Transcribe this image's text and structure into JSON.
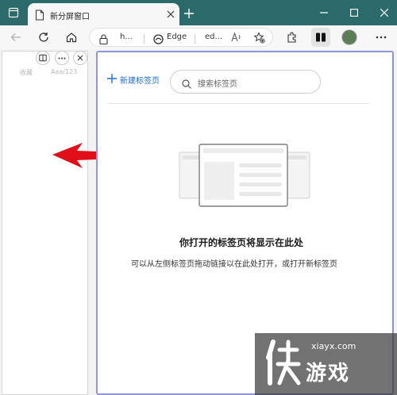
{
  "titlebar": {
    "tab_title": "新分屏窗口",
    "bg_color": "#2b6a6a"
  },
  "toolbar": {
    "address_segment_1": "h...",
    "address_segment_2": "Edge",
    "address_segment_3": "ed..."
  },
  "left_pane": {
    "faded_text_1": "收藏",
    "faded_text_2": "Aaa/123"
  },
  "right_pane": {
    "new_tab_label": "新建标签页",
    "search_placeholder": "搜索标签页",
    "empty_title": "你打开的标签页将显示在此处",
    "empty_subtitle": "可以从左侧标签页拖动链接以在此处打开，或打开新标签页"
  },
  "watermark": {
    "url": "xiayx.com",
    "text": "游戏"
  },
  "colors": {
    "accent_blue": "#1e6fc8",
    "pane_border": "#8f95d9",
    "arrow_red": "#e0101a"
  }
}
